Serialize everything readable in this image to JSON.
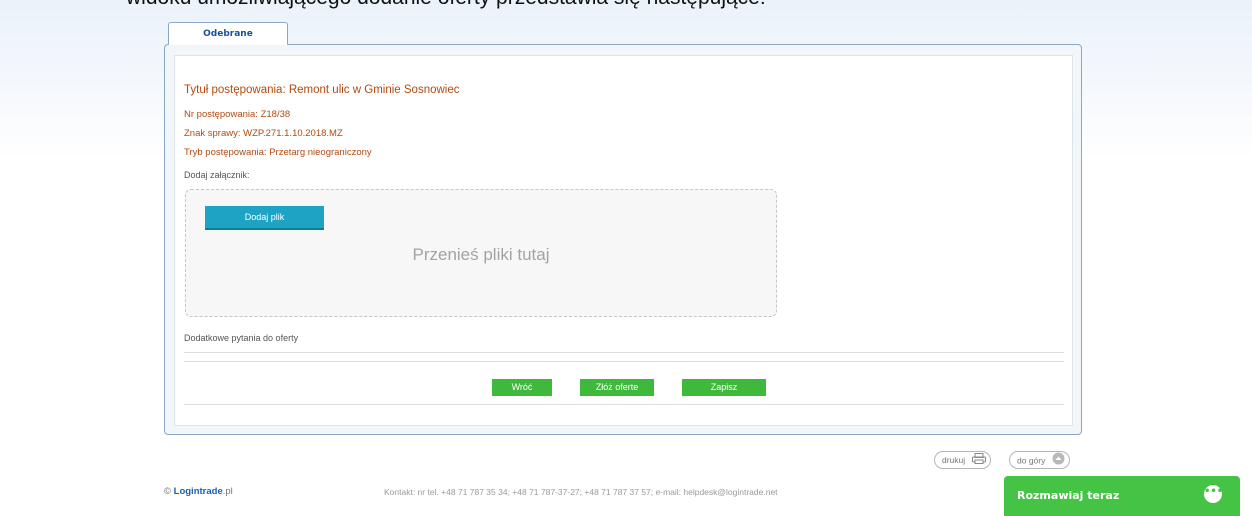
{
  "caption": "widoku umożliwiającego dodanie oferty przedstawia się następujące:",
  "tabs": {
    "received": "Odebrane"
  },
  "procedure": {
    "title": "Tytuł postępowania: Remont ulic w Gminie Sosnowiec",
    "number": "Nr postępowania: Z18/38",
    "case_ref": "Znak sprawy: WZP.271.1.10.2018.MZ",
    "mode": "Tryb postępowania: Przetarg nieograniczony"
  },
  "attachments": {
    "label": "Dodaj załącznik:",
    "add_button": "Dodaj plik",
    "drop_hint": "Przenieś pliki tutaj"
  },
  "questions": {
    "label": "Dodatkowe pytania do oferty"
  },
  "actions": {
    "back": "Wróć",
    "submit": "Złóż oferte",
    "save": "Zapisz"
  },
  "tools": {
    "print": "drukuj",
    "top": "do góry"
  },
  "footer": {
    "brand": "Logintrade",
    "brand_suffix": ".pl",
    "copyright": "©",
    "contact": "Kontakt: nr tel. +48 71 787 35 34; +48 71 787-37-27; +48 71 787 37 57; e-mail: helpdesk@logintrade.net"
  },
  "chat": {
    "label": "Rozmawiaj teraz",
    "icon": "chat-bubble-icon"
  },
  "colors": {
    "accent_green": "#44c344",
    "upload_blue": "#1ea3c5",
    "heading_orange": "#b24a10"
  }
}
